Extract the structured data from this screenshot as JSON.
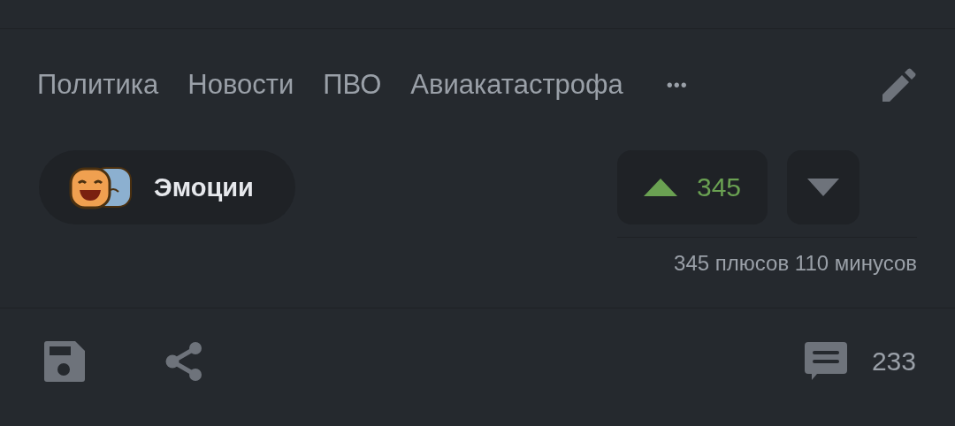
{
  "tags": [
    {
      "label": "Политика"
    },
    {
      "label": "Новости"
    },
    {
      "label": "ПВО"
    },
    {
      "label": "Авиакатастрофа"
    }
  ],
  "more": "•••",
  "emotions": {
    "label": "Эмоции"
  },
  "rating": {
    "upvotes": "345",
    "summary": "345 плюсов 110 минусов"
  },
  "comments": {
    "count": "233"
  }
}
